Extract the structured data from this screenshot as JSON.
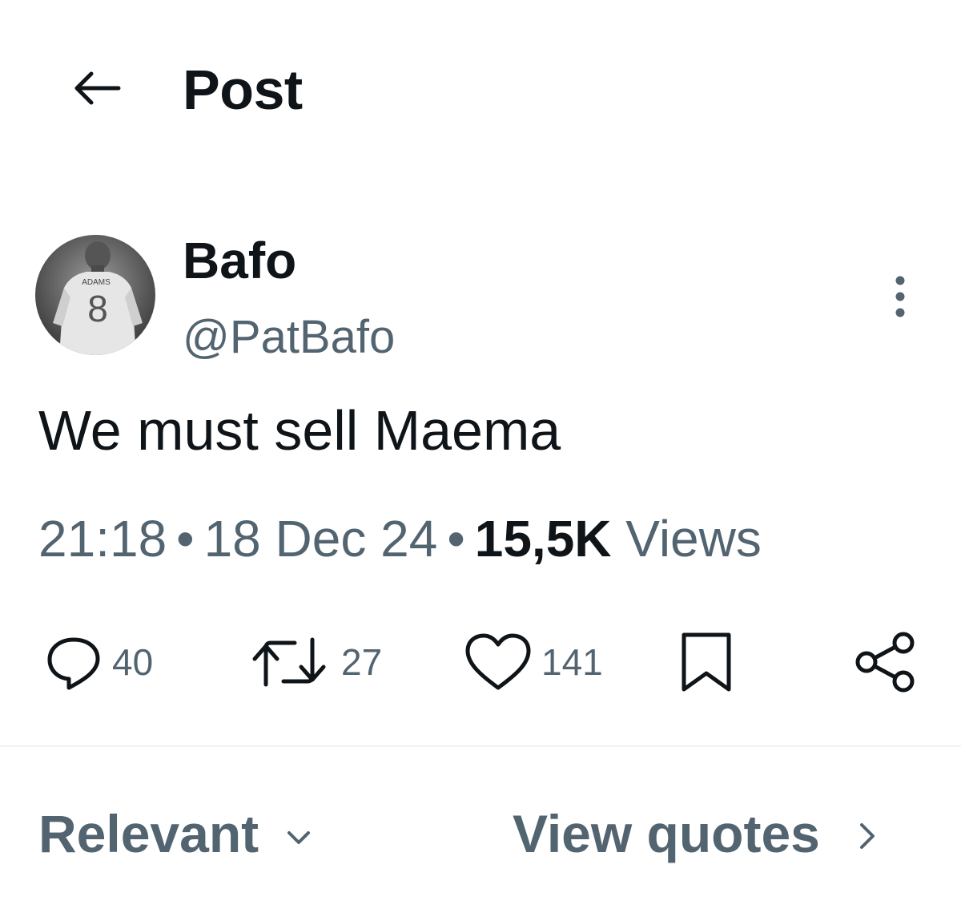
{
  "header": {
    "title": "Post",
    "back_icon": "arrow-left-icon"
  },
  "author": {
    "display_name": "Bafo",
    "handle": "@PatBafo",
    "avatar": {
      "shirt_name": "ADAMS",
      "shirt_number": "8"
    },
    "more_icon": "more-vertical-icon"
  },
  "tweet": {
    "text": "We must sell Maema"
  },
  "meta": {
    "time": "21:18",
    "separator": "•",
    "date": "18 Dec 24",
    "views_count": "15,5K",
    "views_label": "Views"
  },
  "actions": {
    "replies": "40",
    "retweets": "27",
    "likes": "141"
  },
  "bottom": {
    "sort_label": "Relevant",
    "quotes_label": "View quotes"
  },
  "colors": {
    "text_primary": "#0f1419",
    "text_secondary": "#536471",
    "divider": "#eff3f4"
  }
}
